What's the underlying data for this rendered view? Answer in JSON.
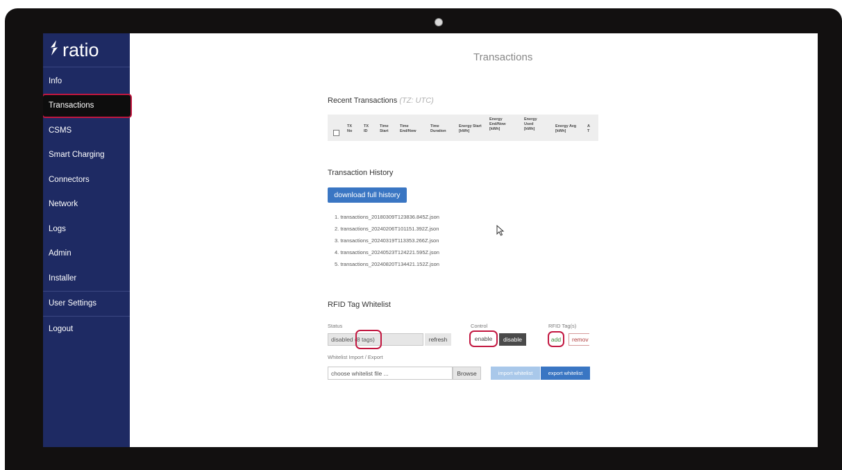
{
  "app": {
    "logo_text": "ratio",
    "logo_icon": "lightning-bolt-icon"
  },
  "sidebar": {
    "items": [
      {
        "label": "Info"
      },
      {
        "label": "Transactions"
      },
      {
        "label": "CSMS"
      },
      {
        "label": "Smart Charging"
      },
      {
        "label": "Connectors"
      },
      {
        "label": "Network"
      },
      {
        "label": "Logs"
      },
      {
        "label": "Admin"
      },
      {
        "label": "Installer"
      },
      {
        "label": "User Settings"
      },
      {
        "label": "Logout"
      }
    ],
    "active": "Transactions"
  },
  "page": {
    "title": "Transactions"
  },
  "recent": {
    "title": "Recent Transactions",
    "tz": "(TZ: UTC)",
    "columns": [
      "TX No",
      "TX ID",
      "Time Start",
      "Time End/Now",
      "Time Duration",
      "Energy Start [kWh]",
      "Energy End/Now [kWh]",
      "Energy Used [kWh]",
      "Energy Avg [kWh]",
      "A T"
    ]
  },
  "history": {
    "title": "Transaction History",
    "download_label": "download full history",
    "files": [
      "1. transactions_20180309T123836.845Z.json",
      "2. transactions_20240206T101151.392Z.json",
      "3. transactions_20240319T113353.266Z.json",
      "4. transactions_20240523T124221.595Z.json",
      "5. transactions_20240820T134421.152Z.json"
    ]
  },
  "rfid": {
    "title": "RFID Tag Whitelist",
    "status_label": "Status",
    "status_value": "disabled (8 tags)",
    "refresh_label": "refresh",
    "control_label": "Control",
    "enable_label": "enable",
    "disable_label": "disable",
    "tags_label": "RFID Tag(s)",
    "add_label": "add",
    "remove_label": "remov",
    "import_export_label": "Whitelist Import / Export",
    "file_placeholder": "choose whitelist file ...",
    "browse_label": "Browse",
    "import_label": "import whitelist",
    "export_label": "export whitelist"
  },
  "colors": {
    "sidebar_bg": "#1e2a63",
    "accent_blue": "#3a76c3",
    "highlight_red": "#c21740"
  }
}
